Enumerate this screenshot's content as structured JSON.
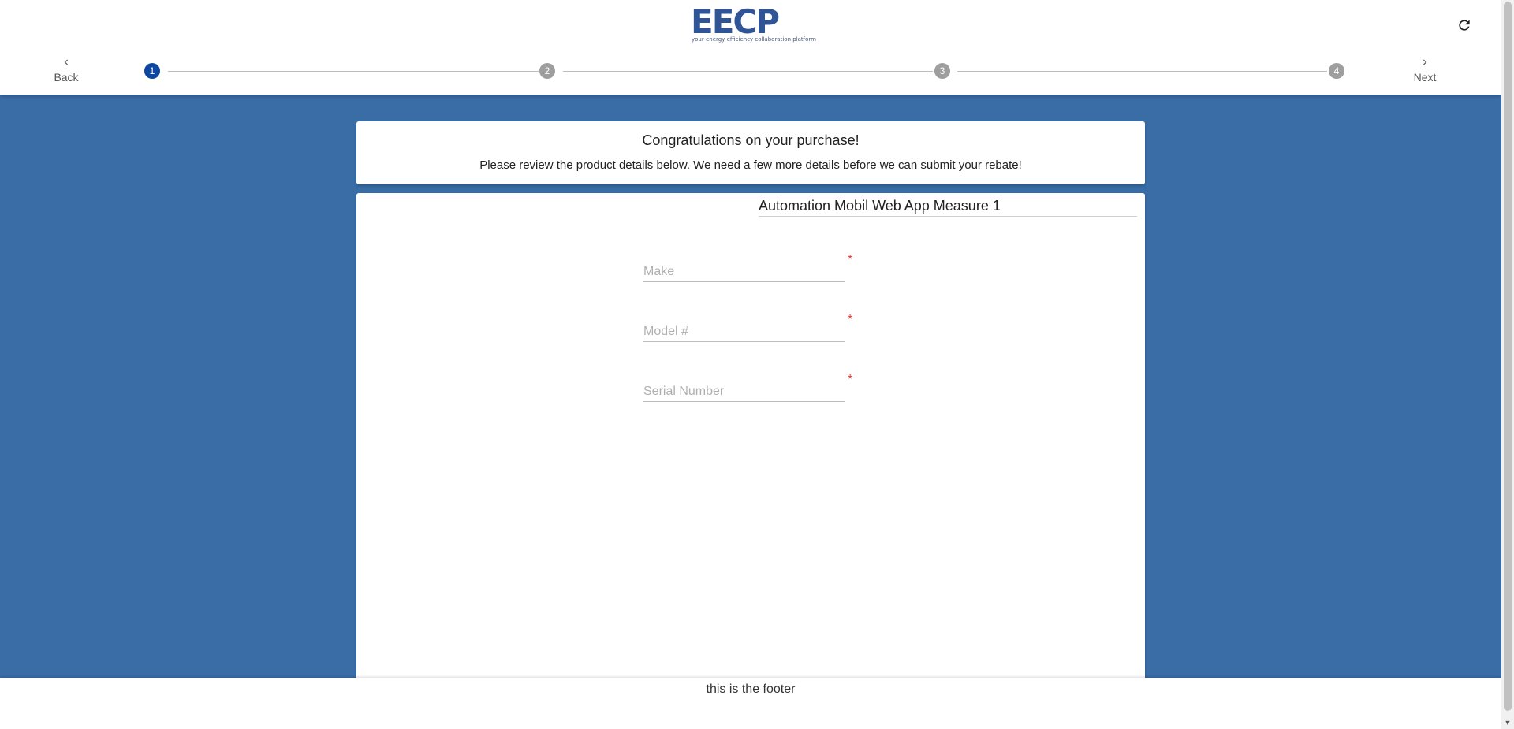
{
  "header": {
    "logo_text": "EECP",
    "logo_tagline": "your energy efficiency collaboration platform",
    "refresh_icon": "refresh-icon",
    "back_label": "Back",
    "next_label": "Next"
  },
  "stepper": {
    "steps": [
      "1",
      "2",
      "3",
      "4"
    ],
    "active_step": 1
  },
  "intro": {
    "title": "Congratulations on your purchase!",
    "subtitle": "Please review the product details below. We need a few more details before we can submit your rebate!"
  },
  "form": {
    "measure_title": "Automation Mobil Web App Measure 1",
    "fields": [
      {
        "placeholder": "Make",
        "value": "",
        "required_mark": "*"
      },
      {
        "placeholder": "Model #",
        "value": "",
        "required_mark": "*"
      },
      {
        "placeholder": "Serial Number",
        "value": "",
        "required_mark": "*"
      }
    ]
  },
  "footer": {
    "text": "this is the footer"
  },
  "colors": {
    "background": "#3a6ca6",
    "brand": "#2f5597",
    "active_step": "#0d47a1",
    "required": "#e53935"
  }
}
